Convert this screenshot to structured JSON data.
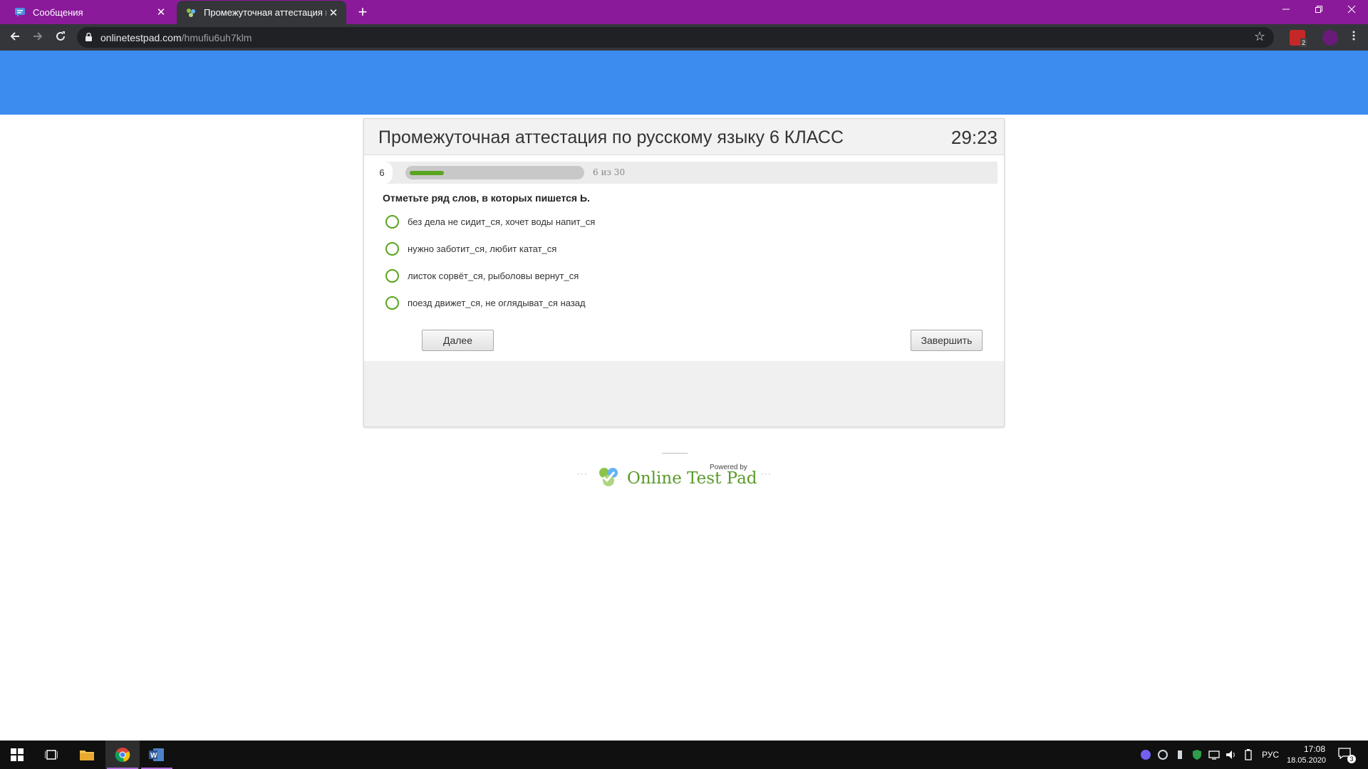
{
  "browser": {
    "tabs": [
      {
        "title": "Сообщения",
        "icon": "chat-icon"
      },
      {
        "title": "Промежуточная аттестация по ",
        "icon": "onlinetestpad-icon"
      }
    ],
    "close_glyph": "✕",
    "new_tab_glyph": "+",
    "url_host": "onlinetestpad.com",
    "url_path": "/hmufiu6uh7klm",
    "extension_badge": "2"
  },
  "test": {
    "title": "Промежуточная аттестация по русскому языку 6 КЛАСС",
    "timer": "29:23",
    "question_number": "6",
    "progress_text": "6 из 30",
    "progress_fraction": 0.2,
    "question": "Отметьте ряд слов, в которых пишется Ь.",
    "answers": [
      "без дела не сидит_ся, хочет воды напит_ся",
      "нужно заботит_ся, любит катат_ся",
      "листок сорвёт_ся, рыболовы вернут_ся",
      "поезд движет_ся, не оглядыват_ся назад"
    ],
    "next_label": "Далее",
    "finish_label": "Завершить"
  },
  "footer": {
    "powered_by": "Powered by",
    "brand": "Online Test Pad",
    "dots": "···"
  },
  "taskbar": {
    "language": "РУС",
    "time": "17:08",
    "date": "18.05.2020",
    "notifications": "3"
  },
  "colors": {
    "tab_bar": "#8b1a9a",
    "banner": "#3c8cf0",
    "accent_green": "#5aa51e"
  }
}
